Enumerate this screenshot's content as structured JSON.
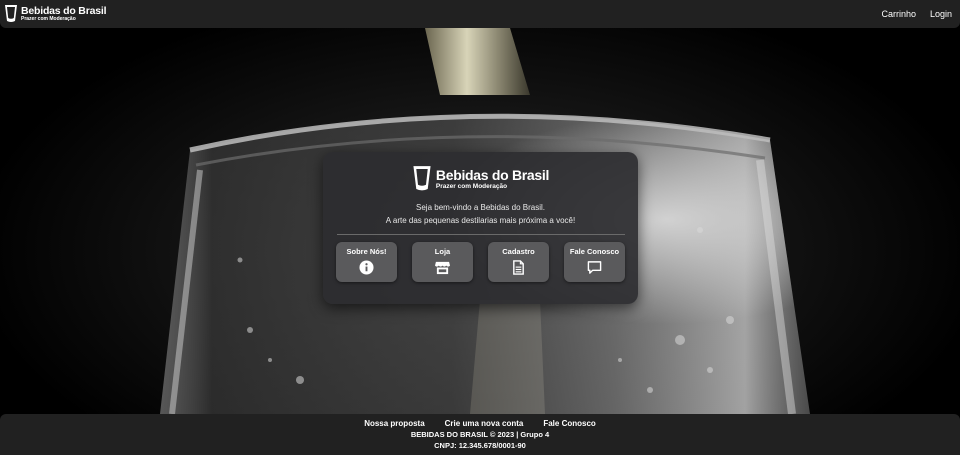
{
  "navbar": {
    "brand_title": "Bebidas do Brasil",
    "brand_subtitle": "Prazer com Moderação",
    "links": [
      "Carrinho",
      "Login"
    ]
  },
  "card": {
    "brand_title": "Bebidas do Brasil",
    "brand_subtitle": "Prazer com Moderação",
    "line1": "Seja bem-vindo a Bebidas do Brasil.",
    "line2": "A arte das pequenas destilarias mais próxima a você!",
    "buttons": [
      {
        "label": "Sobre Nós!",
        "icon": "info-icon"
      },
      {
        "label": "Loja",
        "icon": "store-icon"
      },
      {
        "label": "Cadastro",
        "icon": "document-icon"
      },
      {
        "label": "Fale Conosco",
        "icon": "chat-icon"
      }
    ]
  },
  "footer": {
    "links": [
      "Nossa proposta",
      "Crie uma nova conta",
      "Fale Conosco"
    ],
    "copyright": "BEBIDAS DO BRASIL © 2023 | Grupo 4",
    "cnpj": "CNPJ: 12.345.678/0001-90"
  },
  "colors": {
    "bar_bg": "#212121",
    "card_bg": "#2d2d30",
    "button_bg": "#5a5a5c"
  }
}
